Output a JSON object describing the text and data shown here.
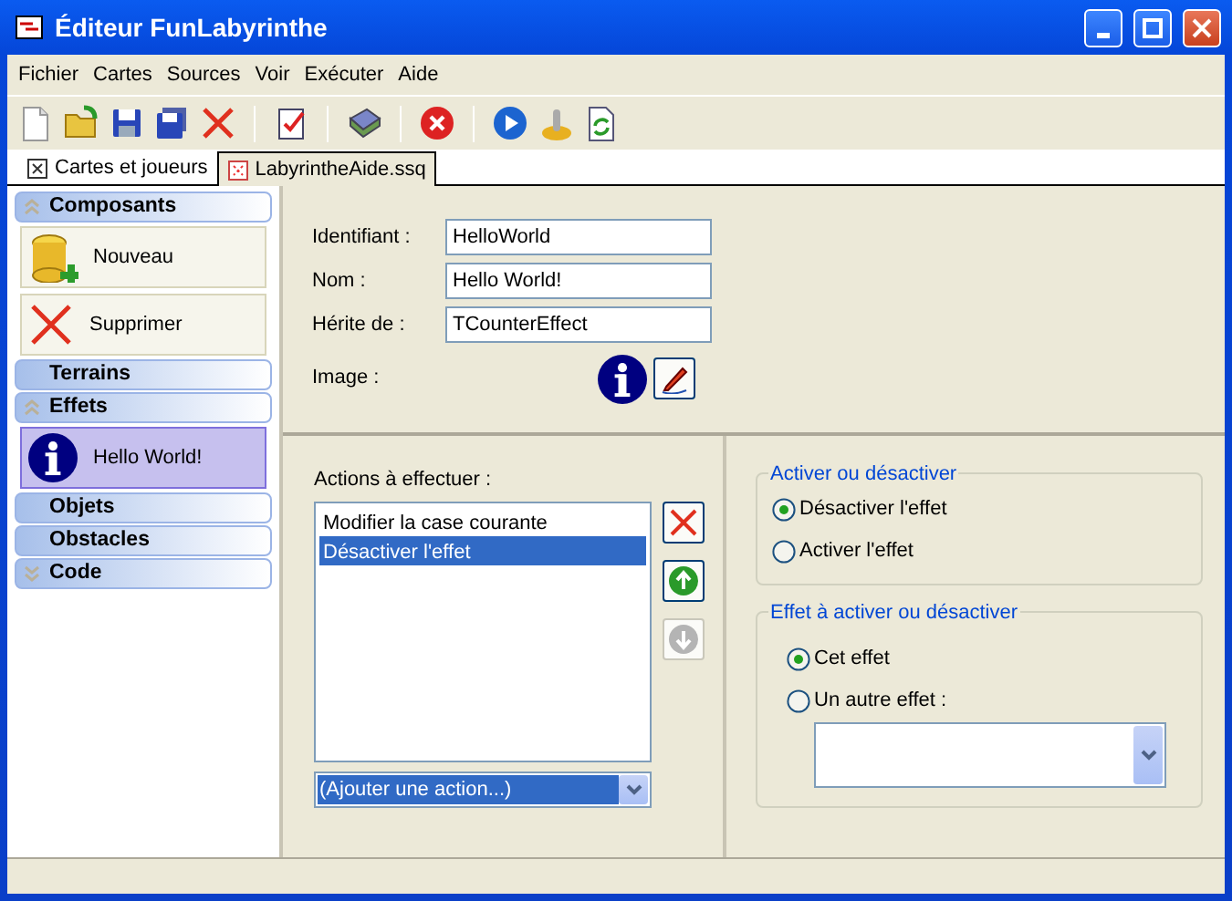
{
  "window": {
    "title": "Éditeur FunLabyrinthe"
  },
  "menu": [
    "Fichier",
    "Cartes",
    "Sources",
    "Voir",
    "Exécuter",
    "Aide"
  ],
  "tabs": [
    {
      "label": "Cartes et joueurs",
      "selected": false
    },
    {
      "label": "LabyrintheAide.ssq",
      "selected": true
    }
  ],
  "sidebar": [
    {
      "kind": "header",
      "label": "Composants",
      "expanded": true
    },
    {
      "kind": "item",
      "label": "Nouveau",
      "selected": false
    },
    {
      "kind": "item",
      "label": "Supprimer",
      "selected": false
    },
    {
      "kind": "header",
      "label": "Terrains"
    },
    {
      "kind": "header",
      "label": "Effets",
      "expanded": true
    },
    {
      "kind": "item",
      "label": "Hello World!",
      "selected": true
    },
    {
      "kind": "header",
      "label": "Objets"
    },
    {
      "kind": "header",
      "label": "Obstacles"
    },
    {
      "kind": "header",
      "label": "Code",
      "expanded": false
    }
  ],
  "form": {
    "fields": [
      {
        "label": "Identifiant :",
        "value": "HelloWorld"
      },
      {
        "label": "Nom :",
        "value": "Hello World!"
      },
      {
        "label": "Hérite de :",
        "value": "TCounterEffect"
      }
    ],
    "image_label": "Image :"
  },
  "actions": {
    "label": "Actions à effectuer :",
    "items": [
      {
        "label": "Modifier la case courante",
        "selected": false
      },
      {
        "label": "Désactiver l'effet",
        "selected": true
      }
    ],
    "buttons": [
      {
        "kind": "delete",
        "disabled": false
      },
      {
        "kind": "up",
        "disabled": false
      },
      {
        "kind": "down",
        "disabled": true
      }
    ],
    "add_combo": "(Ajouter une action...)"
  },
  "toggle_group": {
    "title": "Activer ou désactiver",
    "options": [
      {
        "label": "Désactiver l'effet",
        "selected": true
      },
      {
        "label": "Activer l'effet",
        "selected": false
      }
    ]
  },
  "target_group": {
    "title": "Effet à activer ou désactiver",
    "options": [
      {
        "label": "Cet effet",
        "selected": true
      },
      {
        "label": "Un autre effet :",
        "selected": false
      }
    ]
  }
}
